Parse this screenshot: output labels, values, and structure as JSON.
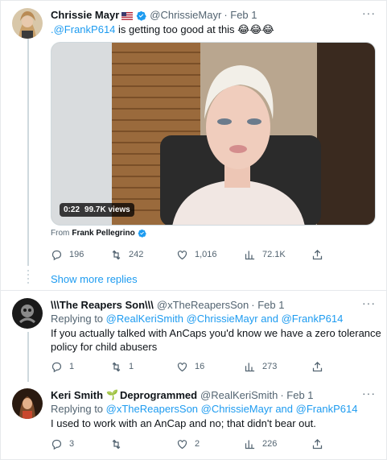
{
  "tweets": [
    {
      "name": "Chrissie Mayr",
      "handle": "@ChrissieMayr",
      "date": "· Feb 1",
      "mention": ".@FrankP614",
      "text_rest": " is getting too good at this 😂😂😂",
      "video": {
        "time": "0:22",
        "views": "99.7K views"
      },
      "from_prefix": "From",
      "from_name": "Frank Pellegrino",
      "replies": "196",
      "retweets": "242",
      "likes": "1,016",
      "views": "72.1K"
    },
    {
      "name": "\\\\\\The Reapers Son\\\\\\",
      "handle": "@xTheReapersSon",
      "date": "· Feb 1",
      "replying_prefix": "Replying to",
      "replying_to": "@RealKeriSmith @ChrissieMayr",
      "replying_and": "and",
      "replying_last": "@FrankP614",
      "text_line1": "If you actually talked with AnCaps you'd know we have a zero tolerance",
      "text_line2": "policy for child abusers",
      "replies": "1",
      "retweets": "1",
      "likes": "16",
      "views": "273"
    },
    {
      "name": "Keri Smith",
      "name_emoji": "🌱",
      "name_suffix": "Deprogrammed",
      "handle": "@RealKeriSmith",
      "date": "· Feb 1",
      "replying_prefix": "Replying to",
      "replying_to": "@xTheReapersSon @ChrissieMayr",
      "replying_and": "and",
      "replying_last": "@FrankP614",
      "text_line1": "I used to work with an AnCap and no; that didn't bear out.",
      "replies": "3",
      "retweets": "",
      "likes": "2",
      "views": "226"
    }
  ],
  "show_more_replies": "Show more replies",
  "more_icon": "···",
  "colors": {
    "link": "#1d9bf0",
    "muted": "#536471",
    "verified": "#1d9bf0"
  },
  "icons": [
    "reply-icon",
    "retweet-icon",
    "like-icon",
    "views-icon",
    "share-icon",
    "verified-icon",
    "more-icon",
    "flag-icon"
  ]
}
